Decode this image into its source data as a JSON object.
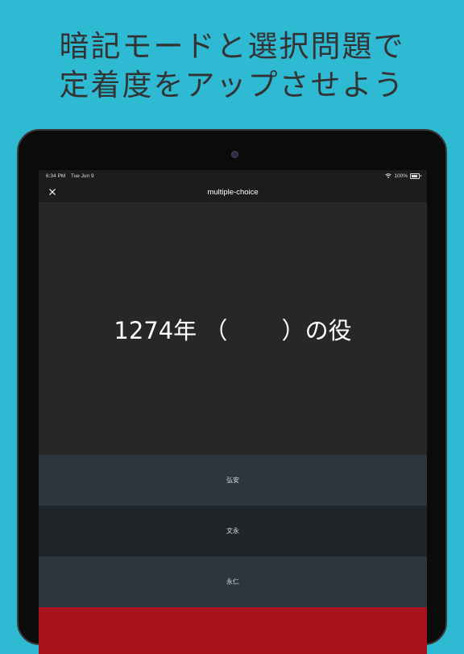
{
  "headline": {
    "line1": "暗記モードと選択問題で",
    "line2": "定着度をアップさせよう"
  },
  "status_bar": {
    "time": "6:34 PM",
    "date": "Tue Jun 9",
    "battery": "100%"
  },
  "nav": {
    "title": "multiple-choice",
    "close_icon": "close-icon"
  },
  "question": {
    "text": "1274年 （　　 ）の役"
  },
  "choices": [
    "弘安",
    "文永",
    "永仁",
    ""
  ],
  "colors": {
    "background": "#2fbad4",
    "screen": "#272727",
    "choice_light": "#2b363e",
    "choice_dark": "#1f2529",
    "choice_red": "#a8141d"
  }
}
